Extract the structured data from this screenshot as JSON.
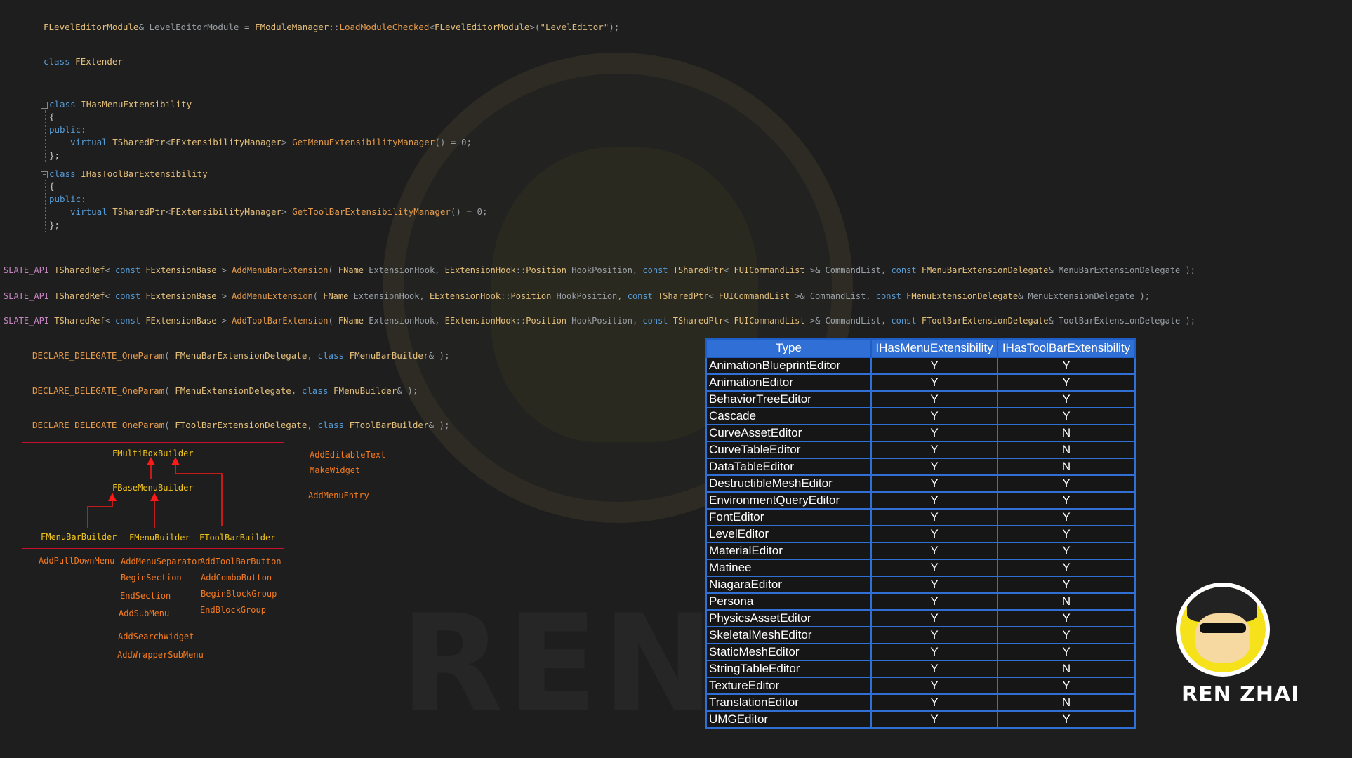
{
  "code": {
    "line_module": {
      "type1": "FLevelEditorModule",
      "amp_var": "& LevelEditorModule = ",
      "mgr": "FModuleManager",
      "sep": "::",
      "fn": "LoadModuleChecked",
      "lt": "<",
      "type2": "FLevelEditorModule",
      "gt_paren": ">(",
      "str": "\"LevelEditor\"",
      "end": ");"
    },
    "line_extender": {
      "kw": "class",
      "name": "FExtender"
    },
    "menu_class": {
      "kw": "class",
      "name": "IHasMenuExtensibility",
      "open": "{",
      "public": "public:",
      "virtual": "virtual",
      "ret": "TSharedPtr",
      "lt": "<",
      "arg": "FExtensibilityManager",
      "gt": ">",
      "fn": "GetMenuExtensibilityManager",
      "tail": "() = 0;",
      "close": "};"
    },
    "toolbar_class": {
      "kw": "class",
      "name": "IHasToolBarExtensibility",
      "open": "{",
      "public": "public:",
      "virtual": "virtual",
      "ret": "TSharedPtr",
      "lt": "<",
      "arg": "FExtensibilityManager",
      "gt": ">",
      "fn": "GetToolBarExtensibilityManager",
      "tail": "() = 0;",
      "close": "};"
    },
    "api_lines": [
      {
        "macro": "SLATE_API",
        "ret": "TSharedRef",
        "lt": "< ",
        "const1": "const",
        "base": "FExtensionBase",
        "gt": " > ",
        "fn": "AddMenuBarExtension",
        "op": "( ",
        "t1": "FName",
        "p1": " ExtensionHook, ",
        "t2": "EExtensionHook",
        "sep": "::",
        "t3": "Position",
        "p2": " HookPosition, ",
        "const2": "const",
        "t4": "TSharedPtr",
        "lt2": "< ",
        "t5": "FUICommandList",
        "p3": " >& CommandList, ",
        "const3": "const",
        "t6": "FMenuBarExtensionDelegate",
        "p4": "& MenuBarExtensionDelegate );"
      },
      {
        "macro": "SLATE_API",
        "ret": "TSharedRef",
        "lt": "< ",
        "const1": "const",
        "base": "FExtensionBase",
        "gt": " > ",
        "fn": "AddMenuExtension",
        "op": "( ",
        "t1": "FName",
        "p1": " ExtensionHook, ",
        "t2": "EExtensionHook",
        "sep": "::",
        "t3": "Position",
        "p2": " HookPosition, ",
        "const2": "const",
        "t4": "TSharedPtr",
        "lt2": "< ",
        "t5": "FUICommandList",
        "p3": " >& CommandList, ",
        "const3": "const",
        "t6": "FMenuExtensionDelegate",
        "p4": "& MenuExtensionDelegate );"
      },
      {
        "macro": "SLATE_API",
        "ret": "TSharedRef",
        "lt": "< ",
        "const1": "const",
        "base": "FExtensionBase",
        "gt": " > ",
        "fn": "AddToolBarExtension",
        "op": "( ",
        "t1": "FName",
        "p1": " ExtensionHook, ",
        "t2": "EExtensionHook",
        "sep": "::",
        "t3": "Position",
        "p2": " HookPosition, ",
        "const2": "const",
        "t4": "TSharedPtr",
        "lt2": "< ",
        "t5": "FUICommandList",
        "p3": " >& CommandList, ",
        "const3": "const",
        "t6": "FToolBarExtensionDelegate",
        "p4": "& ToolBarExtensionDelegate );"
      }
    ],
    "delegates": [
      {
        "macro": "DECLARE_DELEGATE_OneParam",
        "op": "( ",
        "name": "FMenuBarExtensionDelegate",
        "comma": ", ",
        "kw": "class",
        "arg": " FMenuBarBuilder",
        "tail": "& );"
      },
      {
        "macro": "DECLARE_DELEGATE_OneParam",
        "op": "( ",
        "name": "FMenuExtensionDelegate",
        "comma": ", ",
        "kw": "class",
        "arg": " FMenuBuilder",
        "tail": "& );"
      },
      {
        "macro": "DECLARE_DELEGATE_OneParam",
        "op": "( ",
        "name": "FToolBarExtensionDelegate",
        "comma": ", ",
        "kw": "class",
        "arg": " FToolBarBuilder",
        "tail": "& );"
      }
    ]
  },
  "diagram": {
    "root": "FMultiBoxBuilder",
    "mid": "FBaseMenuBuilder",
    "leaf_menubar": "FMenuBarBuilder",
    "leaf_menu": "FMenuBuilder",
    "leaf_toolbar": "FToolBarBuilder",
    "root_methods": [
      "AddEditableText",
      "MakeWidget"
    ],
    "mid_methods": [
      "AddMenuEntry"
    ],
    "menubar_methods": [
      "AddPullDownMenu"
    ],
    "menu_methods": [
      "AddMenuSeparator",
      "BeginSection",
      "EndSection",
      "AddSubMenu",
      "AddSearchWidget",
      "AddWrapperSubMenu"
    ],
    "toolbar_methods": [
      "AddToolBarButton",
      "AddComboButton",
      "BeginBlockGroup",
      "EndBlockGroup"
    ],
    "arrow_color": "#ff1a1a"
  },
  "table": {
    "headers": [
      "Type",
      "IHasMenuExtensibility",
      "IHasToolBarExtensibility"
    ],
    "rows": [
      [
        "AnimationBlueprintEditor",
        "Y",
        "Y"
      ],
      [
        "AnimationEditor",
        "Y",
        "Y"
      ],
      [
        "BehaviorTreeEditor",
        "Y",
        "Y"
      ],
      [
        "Cascade",
        "Y",
        "Y"
      ],
      [
        "CurveAssetEditor",
        "Y",
        "N"
      ],
      [
        "CurveTableEditor",
        "Y",
        "N"
      ],
      [
        "DataTableEditor",
        "Y",
        "N"
      ],
      [
        "DestructibleMeshEditor",
        "Y",
        "Y"
      ],
      [
        "EnvironmentQueryEditor",
        "Y",
        "Y"
      ],
      [
        "FontEditor",
        "Y",
        "Y"
      ],
      [
        "LevelEditor",
        "Y",
        "Y"
      ],
      [
        "MaterialEditor",
        "Y",
        "Y"
      ],
      [
        "Matinee",
        "Y",
        "Y"
      ],
      [
        "NiagaraEditor",
        "Y",
        "Y"
      ],
      [
        "Persona",
        "Y",
        "N"
      ],
      [
        "PhysicsAssetEditor",
        "Y",
        "Y"
      ],
      [
        "SkeletalMeshEditor",
        "Y",
        "Y"
      ],
      [
        "StaticMeshEditor",
        "Y",
        "Y"
      ],
      [
        "StringTableEditor",
        "Y",
        "N"
      ],
      [
        "TextureEditor",
        "Y",
        "Y"
      ],
      [
        "TranslationEditor",
        "Y",
        "N"
      ],
      [
        "UMGEditor",
        "Y",
        "Y"
      ]
    ],
    "header_color": "#2f6fd6"
  },
  "branding": {
    "logo_text": "REN ZHAI",
    "watermark_text": "REN ZHAI",
    "logo_icon": "character-avatar-icon"
  }
}
